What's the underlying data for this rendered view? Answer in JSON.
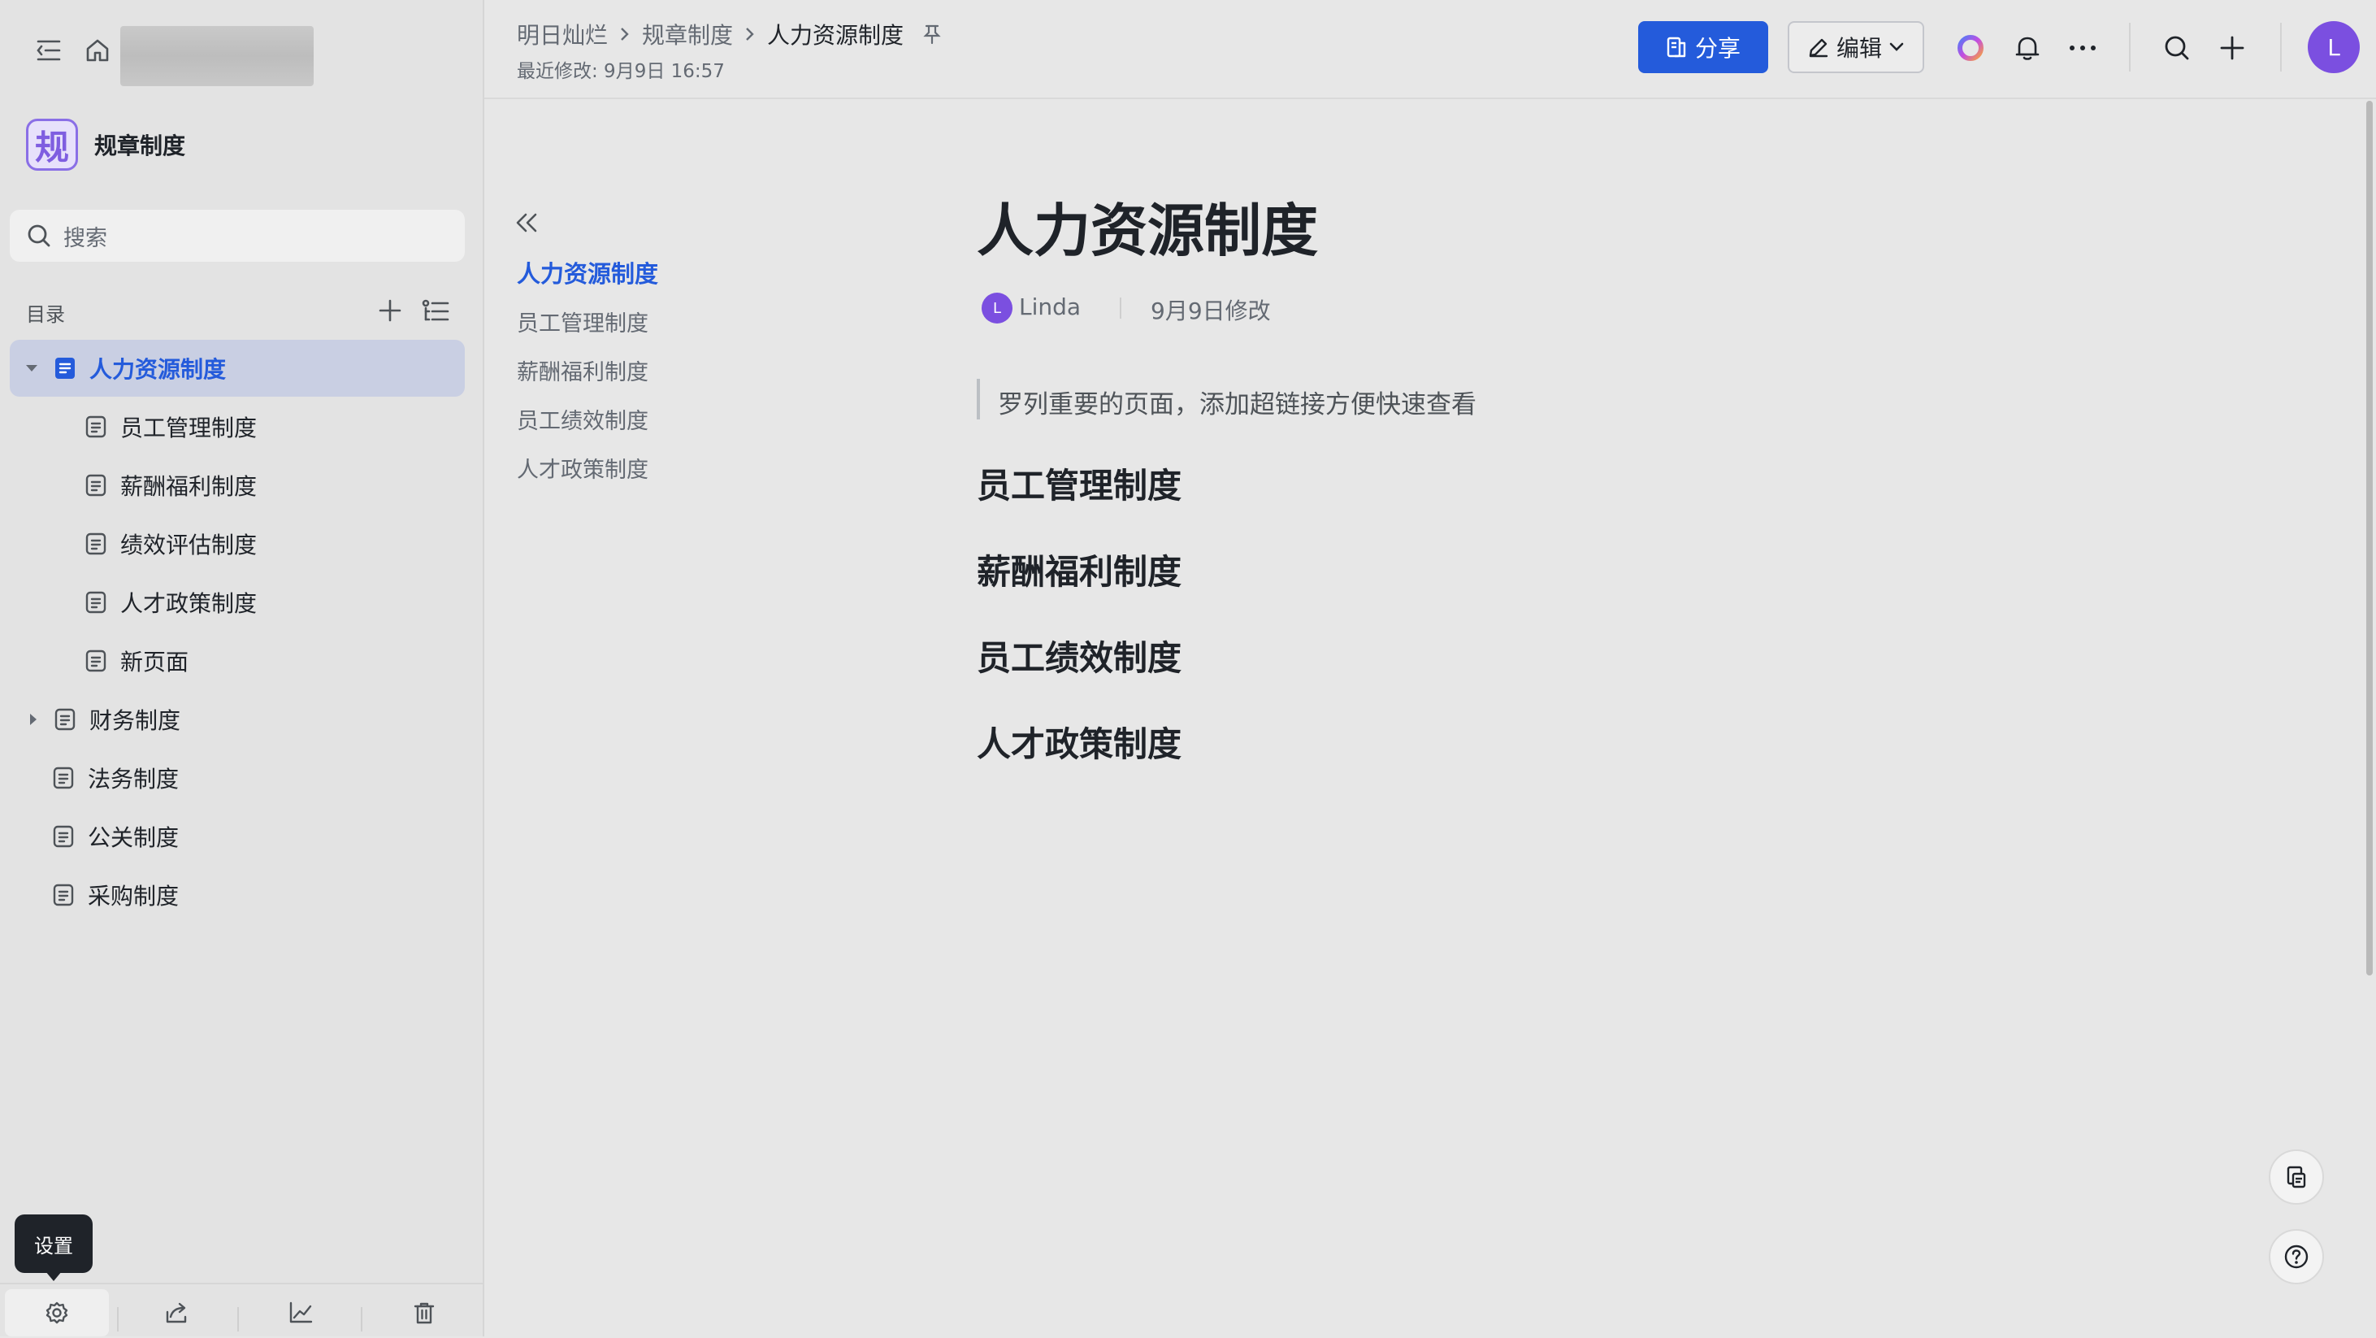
{
  "sidebar": {
    "space_logo_char": "规",
    "space_name": "规章制度",
    "search_placeholder": "搜索",
    "toc_label": "目录",
    "tree": [
      {
        "label": "人力资源制度",
        "level": 0,
        "expanded": true,
        "active": true
      },
      {
        "label": "员工管理制度",
        "level": 1
      },
      {
        "label": "薪酬福利制度",
        "level": 1
      },
      {
        "label": "绩效评估制度",
        "level": 1
      },
      {
        "label": "人才政策制度",
        "level": 1
      },
      {
        "label": "新页面",
        "level": 1
      },
      {
        "label": "财务制度",
        "level": 0,
        "expanded": false
      },
      {
        "label": "法务制度",
        "level": 0
      },
      {
        "label": "公关制度",
        "level": 0
      },
      {
        "label": "采购制度",
        "level": 0
      }
    ],
    "tooltip": "设置"
  },
  "header": {
    "breadcrumb": [
      "明日灿烂",
      "规章制度",
      "人力资源制度"
    ],
    "last_modified": "最近修改: 9月9日 16:57",
    "share_label": "分享",
    "edit_label": "编辑",
    "avatar_initial": "L"
  },
  "outline": {
    "items": [
      "人力资源制度",
      "员工管理制度",
      "薪酬福利制度",
      "员工绩效制度",
      "人才政策制度"
    ]
  },
  "document": {
    "title": "人力资源制度",
    "author_initial": "L",
    "author": "Linda",
    "modified": "9月9日修改",
    "quote": "罗列重要的页面，添加超链接方便快速查看",
    "headings": [
      "员工管理制度",
      "薪酬福利制度",
      "员工绩效制度",
      "人才政策制度"
    ]
  },
  "colors": {
    "accent": "#245bdb",
    "active_bg": "#c9cfe3",
    "avatar": "#7b4fe0"
  }
}
